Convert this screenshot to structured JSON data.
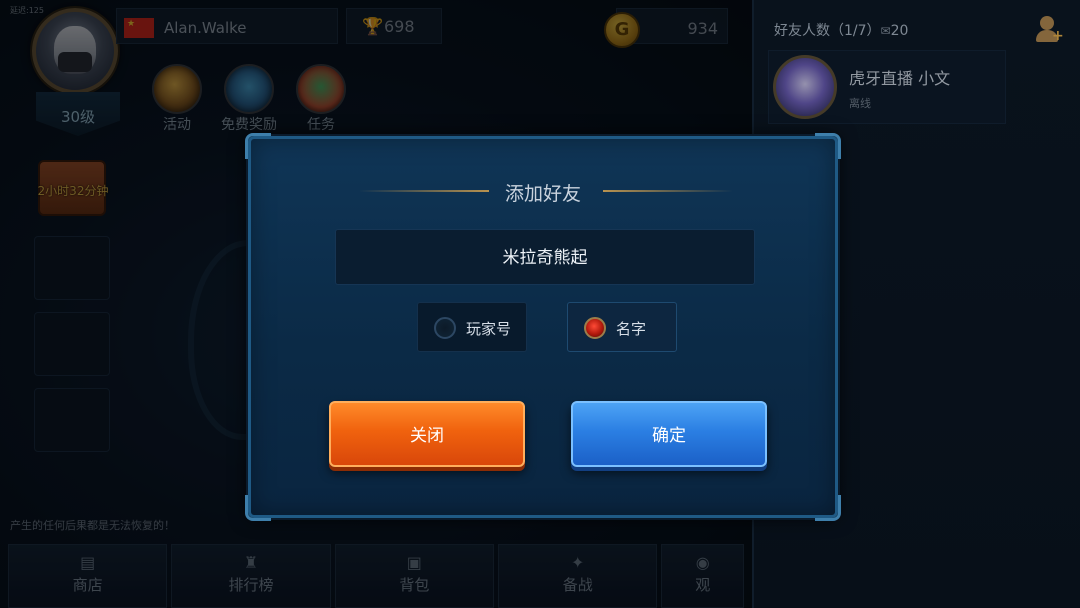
{
  "hud": {
    "fps_text": "延迟:125",
    "player_name": "Alan.Walke",
    "level": "30级",
    "trophies": "698",
    "coins": "934",
    "chest_timer": "2小时32分钟",
    "warning_text": "产生的任何后果都是无法恢复的！"
  },
  "quick_actions": [
    {
      "label": "活动",
      "icon": "event-icon"
    },
    {
      "label": "免费奖励",
      "icon": "free-reward-icon"
    },
    {
      "label": "任务",
      "icon": "task-icon"
    }
  ],
  "bottom_nav": [
    {
      "label": "商店",
      "icon": "shop-icon"
    },
    {
      "label": "排行榜",
      "icon": "trophy-icon"
    },
    {
      "label": "背包",
      "icon": "backpack-icon"
    },
    {
      "label": "备战",
      "icon": "battle-prep-icon"
    },
    {
      "label": "观",
      "icon": "watch-icon"
    }
  ],
  "friends": {
    "count_label": "好友人数（1/7）",
    "count_extra": "20",
    "list": [
      {
        "name": "虎牙直播  小文",
        "status": "离线"
      }
    ]
  },
  "dialog": {
    "title": "添加好友",
    "input_value": "米拉奇熊起",
    "options": [
      {
        "label": "玩家号",
        "selected": false
      },
      {
        "label": "名字",
        "selected": true
      }
    ],
    "close_label": "关闭",
    "confirm_label": "确定"
  },
  "colors": {
    "close_button": "#f0620e",
    "confirm_button": "#2b7fe3",
    "panel_bg": "#0b2a46",
    "accent_gold": "#b8924f"
  }
}
